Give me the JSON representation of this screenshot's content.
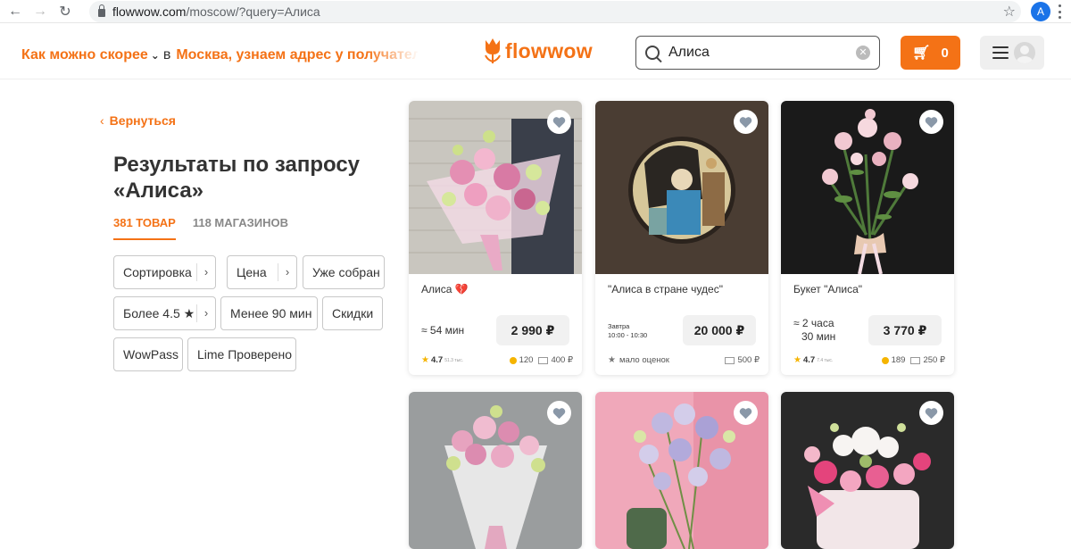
{
  "browser": {
    "url_host": "flowwow.com",
    "url_path": "/moscow/?query=Алиса",
    "profile_initial": "A"
  },
  "header": {
    "delivery_when": "Как можно скорее",
    "delivery_in": "в",
    "delivery_where": "Москва, узнаем адрес у получателя",
    "logo_text": "flowwow",
    "search_value": "Алиса",
    "cart_count": "0"
  },
  "sidebar": {
    "back_label": "Вернуться",
    "title": "Результаты по запросу «Алиса»",
    "tabs": [
      {
        "label": "381 ТОВАР",
        "active": true
      },
      {
        "label": "118 МАГАЗИНОВ",
        "active": false
      }
    ],
    "filters": {
      "sort": "Сортировка",
      "price": "Цена",
      "ready": "Уже собран",
      "rating": "Более 4.5 ★",
      "fast": "Менее 90 мин",
      "discounts": "Скидки",
      "wowpass": "WowPass",
      "lime": "Lime Проверено"
    }
  },
  "products": [
    {
      "name": "Алиса 💔",
      "time": "≈ 54 мин",
      "price": "2 990 ₽",
      "rating": "4.7",
      "rating_sub": "51.3 тыс.",
      "bonus": "120",
      "delivery": "400 ₽"
    },
    {
      "name": "\"Алиса в стране чудес\"",
      "time_line1": "Завтра",
      "time_line2": "10:00 - 10:30",
      "price": "20 000 ₽",
      "rating_text": "мало оценок",
      "delivery": "500 ₽"
    },
    {
      "name": "Букет \"Алиса\"",
      "time_line1": "≈ 2 часа",
      "time_line2": "30 мин",
      "price": "3 770 ₽",
      "rating": "4.7",
      "rating_sub": "7.4 тыс.",
      "bonus": "189",
      "delivery": "250 ₽"
    }
  ],
  "colors": {
    "brand": "#f47216",
    "chip_border": "#c8c8c8"
  }
}
